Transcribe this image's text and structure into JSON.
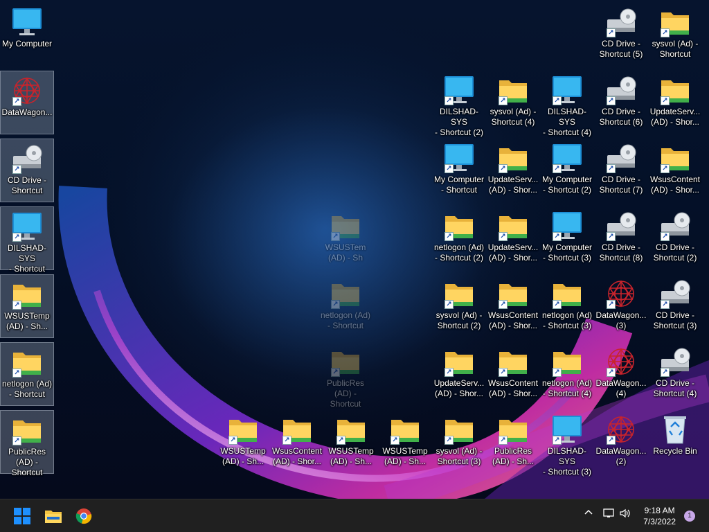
{
  "desktop": {
    "icons": [
      {
        "label": "My Computer",
        "type": "monitor",
        "shortcut": false,
        "selected": false
      },
      {
        "label": "DataWagon...",
        "type": "datawagon",
        "shortcut": true,
        "selected": true
      },
      {
        "label": "CD Drive -\nShortcut",
        "type": "cd",
        "shortcut": true,
        "selected": true
      },
      {
        "label": "DILSHAD-SYS\n- Shortcut",
        "type": "monitor",
        "shortcut": true,
        "selected": true
      },
      {
        "label": "WSUSTemp\n(AD) - Sh...",
        "type": "folder",
        "shortcut": true,
        "selected": true
      },
      {
        "label": "netlogon (Ad)\n- Shortcut",
        "type": "folder",
        "shortcut": true,
        "selected": true
      },
      {
        "label": "PublicRes\n(AD) -\nShortcut",
        "type": "folder",
        "shortcut": true,
        "selected": true
      },
      {
        "label": "CD Drive -\nShortcut (5)",
        "type": "cd",
        "shortcut": true
      },
      {
        "label": "sysvol (Ad) -\nShortcut",
        "type": "folder",
        "shortcut": true
      },
      {
        "label": "DILSHAD-SYS\n- Shortcut (2)",
        "type": "monitor",
        "shortcut": true
      },
      {
        "label": "sysvol (Ad) -\nShortcut (4)",
        "type": "folder",
        "shortcut": true
      },
      {
        "label": "DILSHAD-SYS\n- Shortcut (4)",
        "type": "monitor",
        "shortcut": true
      },
      {
        "label": "CD Drive -\nShortcut (6)",
        "type": "cd",
        "shortcut": true
      },
      {
        "label": "UpdateServ...\n(AD) - Shor...",
        "type": "folder",
        "shortcut": true
      },
      {
        "label": "My Computer\n- Shortcut",
        "type": "monitor",
        "shortcut": true
      },
      {
        "label": "UpdateServ...\n(AD) - Shor...",
        "type": "folder",
        "shortcut": true
      },
      {
        "label": "My Computer\n- Shortcut (2)",
        "type": "monitor",
        "shortcut": true
      },
      {
        "label": "CD Drive -\nShortcut (7)",
        "type": "cd",
        "shortcut": true
      },
      {
        "label": "WsusContent\n(AD) - Shor...",
        "type": "folder",
        "shortcut": true
      },
      {
        "label": "netlogon (Ad)\n- Shortcut (2)",
        "type": "folder",
        "shortcut": true
      },
      {
        "label": "UpdateServ...\n(AD) - Shor...",
        "type": "folder",
        "shortcut": true
      },
      {
        "label": "My Computer\n- Shortcut (3)",
        "type": "monitor",
        "shortcut": true
      },
      {
        "label": "CD Drive -\nShortcut (8)",
        "type": "cd",
        "shortcut": true
      },
      {
        "label": "CD Drive -\nShortcut (2)",
        "type": "cd",
        "shortcut": true
      },
      {
        "label": "sysvol (Ad) -\nShortcut (2)",
        "type": "folder",
        "shortcut": true
      },
      {
        "label": "WsusContent\n(AD) - Shor...",
        "type": "folder",
        "shortcut": true
      },
      {
        "label": "netlogon (Ad)\n- Shortcut (3)",
        "type": "folder",
        "shortcut": true
      },
      {
        "label": "DataWagon...\n(3)",
        "type": "datawagon",
        "shortcut": true
      },
      {
        "label": "CD Drive -\nShortcut (3)",
        "type": "cd",
        "shortcut": true
      },
      {
        "label": "UpdateServ...\n(AD) - Shor...",
        "type": "folder",
        "shortcut": true
      },
      {
        "label": "WsusContent\n(AD) - Shor...",
        "type": "folder",
        "shortcut": true
      },
      {
        "label": "netlogon (Ad)\n- Shortcut (4)",
        "type": "folder",
        "shortcut": true
      },
      {
        "label": "DataWagon...\n(4)",
        "type": "datawagon",
        "shortcut": true
      },
      {
        "label": "CD Drive -\nShortcut (4)",
        "type": "cd",
        "shortcut": true
      },
      {
        "label": "WSUSTemp\n(AD) - Sh...",
        "type": "folder",
        "shortcut": true
      },
      {
        "label": "WsusContent\n(AD) - Shor...",
        "type": "folder",
        "shortcut": true
      },
      {
        "label": "WSUSTemp\n(AD) - Sh...",
        "type": "folder",
        "shortcut": true
      },
      {
        "label": "WSUSTemp\n(AD) - Sh...",
        "type": "folder",
        "shortcut": true
      },
      {
        "label": "sysvol (Ad) -\nShortcut (3)",
        "type": "folder",
        "shortcut": true
      },
      {
        "label": "PublicRes\n(AD) - Sh...",
        "type": "folder",
        "shortcut": true
      },
      {
        "label": "DILSHAD-SYS\n- Shortcut (3)",
        "type": "monitor",
        "shortcut": true
      },
      {
        "label": "DataWagon...\n(2)",
        "type": "datawagon",
        "shortcut": true
      },
      {
        "label": "Recycle Bin",
        "type": "recycle",
        "shortcut": false
      },
      {
        "label": "WSUSTem\n(AD) - Sh",
        "type": "folder",
        "shortcut": true,
        "ghost": true
      },
      {
        "label": "netlogon (Ad)\n- Shortcut",
        "type": "folder",
        "shortcut": true,
        "ghost": true
      },
      {
        "label": "PublicRes\n(AD) -\nShortcut",
        "type": "folder",
        "shortcut": true,
        "ghost": true
      }
    ]
  },
  "taskbar": {
    "apps": [
      "start-button",
      "file-explorer",
      "chrome"
    ],
    "tray_chevron": "^",
    "clock_time": "9:18 AM",
    "clock_date": "7/3/2022",
    "notification_count": "1"
  },
  "colors": {
    "taskbar_bg": "#202020",
    "folder_yellow": "#f5c542",
    "monitor_blue": "#29a9e8",
    "start_blue": "#1e90ff"
  }
}
